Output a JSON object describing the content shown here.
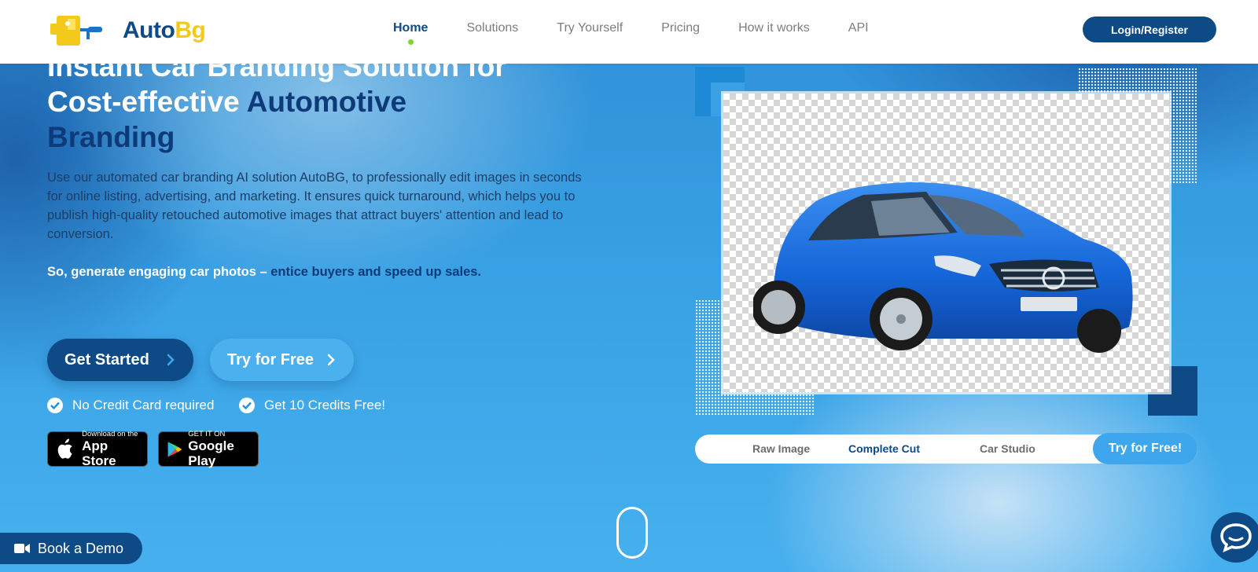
{
  "header": {
    "logo": {
      "part1": "Auto",
      "part2": "Bg"
    },
    "nav": [
      {
        "label": "Home",
        "active": true
      },
      {
        "label": "Solutions"
      },
      {
        "label": "Try Yourself"
      },
      {
        "label": "Pricing"
      },
      {
        "label": "How it works"
      },
      {
        "label": "API"
      }
    ],
    "login_label": "Login/Register"
  },
  "hero": {
    "headline_white_1": "Instant Car Branding Solution for",
    "headline_white_2": "Cost-effective ",
    "headline_dark_2": "Automotive",
    "headline_dark_3": "Branding",
    "paragraph": "Use our automated car branding AI solution AutoBG, to professionally edit images in seconds for online listing, advertising, and marketing. It ensures quick turnaround, which helps you to publish high-quality retouched automotive images that attract buyers' attention and lead to conversion.",
    "tagline_white": "So, generate engaging car photos – ",
    "tagline_dark": "entice buyers and speed up sales.",
    "primary_cta": "Get Started",
    "secondary_cta": "Try for Free",
    "checks": [
      "No Credit Card required",
      "Get 10 Credits Free!"
    ],
    "stores": {
      "apple": {
        "small": "Download on the",
        "big": "App Store"
      },
      "google": {
        "small": "GET IT ON",
        "big": "Google Play"
      }
    }
  },
  "preview": {
    "tabs": [
      {
        "label": "Raw Image"
      },
      {
        "label": "Complete Cut",
        "active": true
      },
      {
        "label": "Car Studio"
      }
    ],
    "cta": "Try for Free!"
  },
  "floating": {
    "demo_label": "Book a Demo"
  },
  "colors": {
    "brand_dark": "#0d4a86",
    "brand_yellow": "#f3c91c",
    "accent_light": "#3ea6ec",
    "active_dot": "#7fd33b"
  },
  "icons": [
    "logo-icon",
    "chevron-right-icon",
    "check-icon",
    "apple-icon",
    "google-play-icon",
    "video-camera-icon",
    "chat-icon",
    "scroll-mouse-icon"
  ]
}
